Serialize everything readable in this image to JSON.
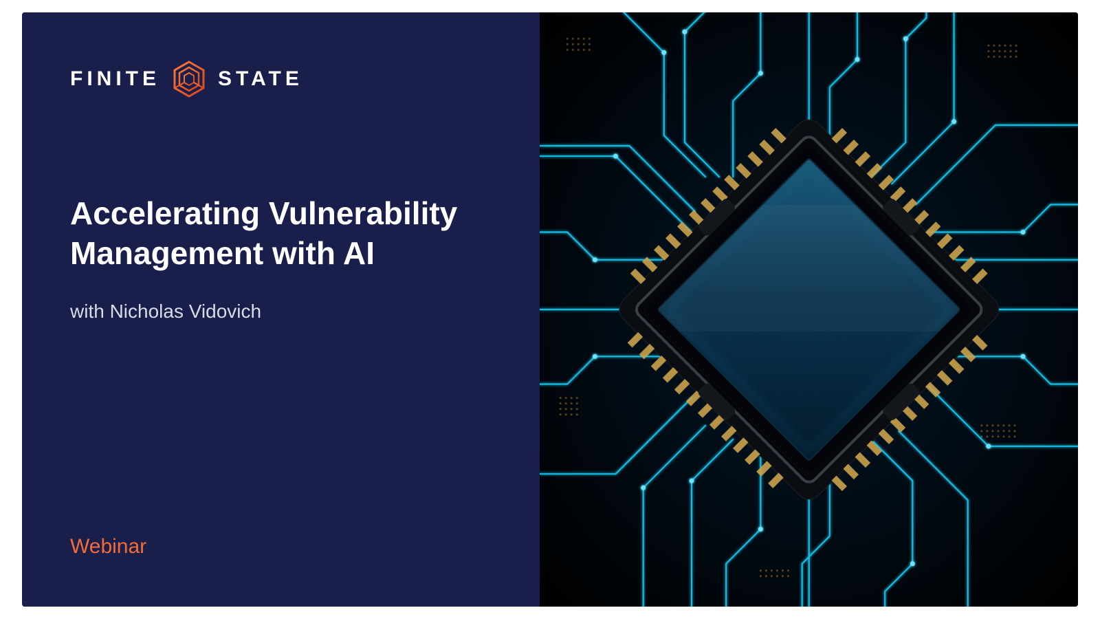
{
  "brand": {
    "word_left": "FINITE",
    "word_right": "STATE",
    "icon_name": "hexagon-logo-icon"
  },
  "title": "Accelerating Vulnerability Management with AI",
  "subtitle": "with Nicholas Vidovich",
  "category_label": "Webinar",
  "colors": {
    "background_navy": "#1a1e4a",
    "accent_orange": "#f26c3a",
    "circuit_cyan": "#18c8f0"
  },
  "right_image": {
    "description": "Rendered microchip on dark PCB with glowing cyan circuit traces radiating outward",
    "icon_name": "circuit-chip-illustration"
  }
}
